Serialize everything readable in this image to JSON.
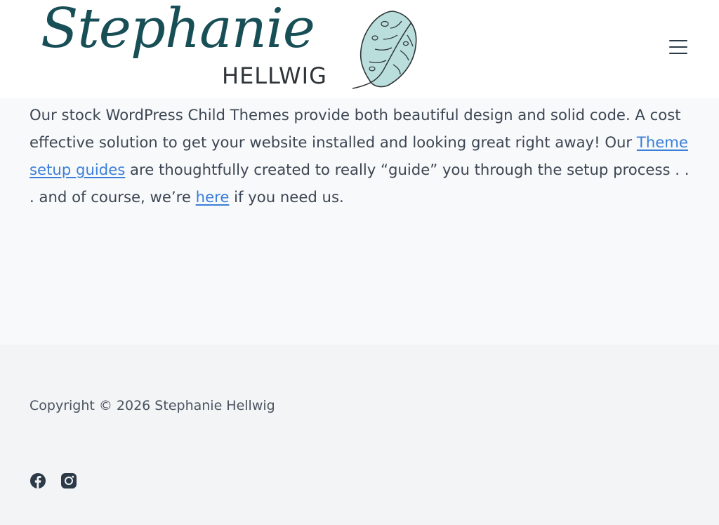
{
  "header": {
    "logo": {
      "script_text": "Stephanie",
      "sub_text": "HELLWIG",
      "leaf_icon": "monstera-leaf-icon"
    },
    "menu_icon": "hamburger-menu-icon"
  },
  "main": {
    "intro": {
      "text_1": "Our stock WordPress Child Themes provide both beautiful design and solid code.  A cost effective solution to get your website installed and looking great right away!   Our ",
      "link_1": "Theme setup guides",
      "text_2": " are thoughtfully created to really “guide” you through the setup process . . . and of course, we’re ",
      "link_2": "here",
      "text_3": " if you need us."
    }
  },
  "footer": {
    "copyright": "Copyright © 2026 Stephanie Hellwig",
    "social": [
      {
        "icon": "facebook-icon"
      },
      {
        "icon": "instagram-icon"
      }
    ]
  },
  "colors": {
    "brand_teal": "#184f57",
    "leaf_fill": "#b9dedb",
    "link": "#3b7fd8",
    "body_text": "#3d4652",
    "footer_bg": "#f2f4f6"
  }
}
